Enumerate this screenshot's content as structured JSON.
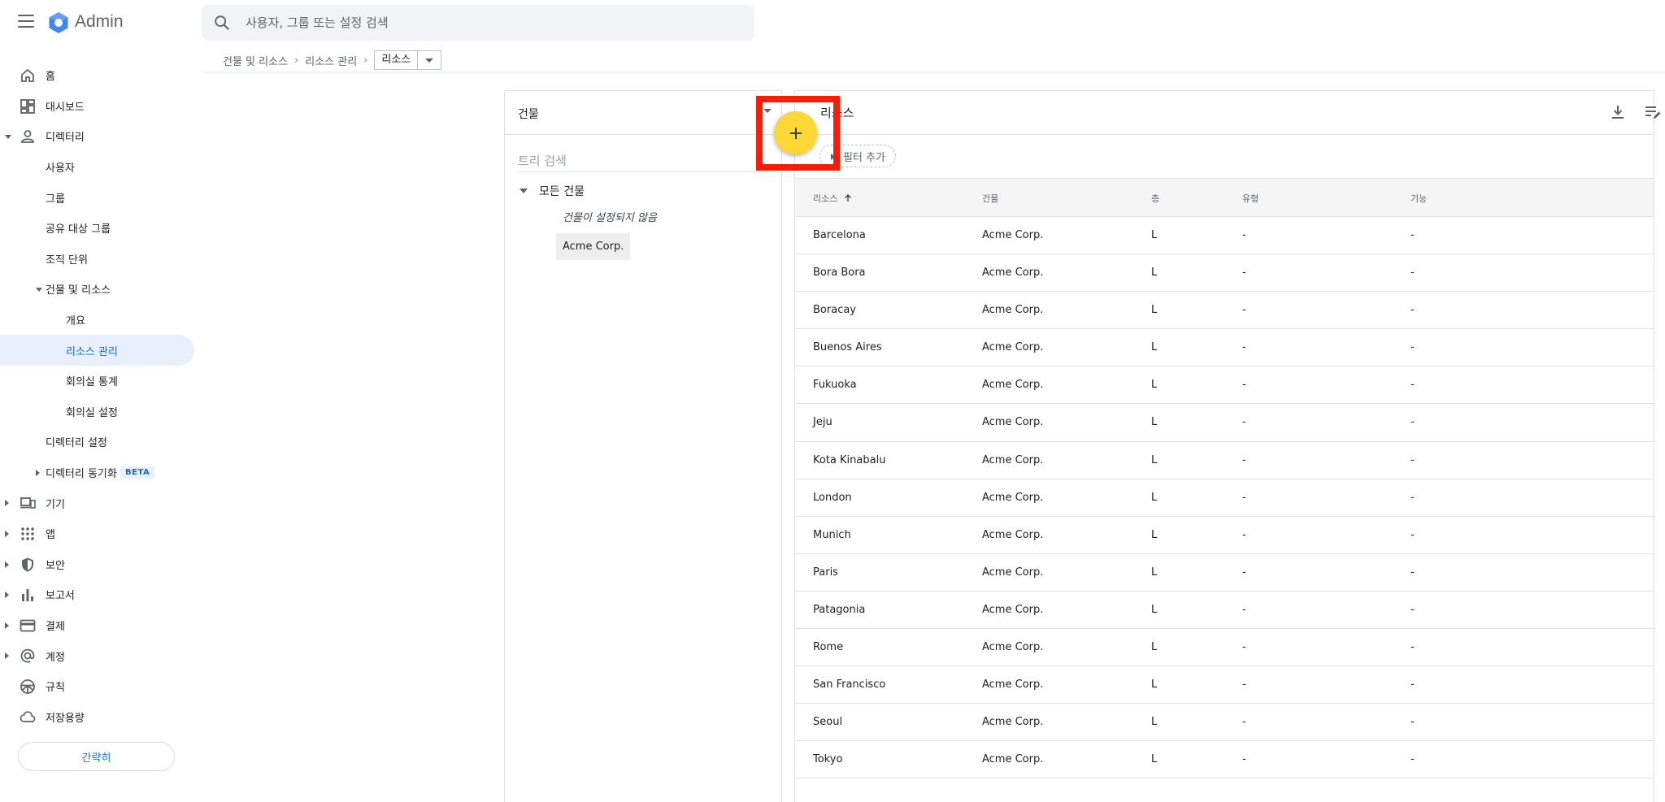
{
  "header": {
    "app_name": "Admin",
    "search_placeholder": "사용자, 그룹 또는 설정 검색"
  },
  "breadcrumb": {
    "items": [
      "건물 및 리소스",
      "리소스 관리"
    ],
    "current": "리소스"
  },
  "sidebar": {
    "items": [
      {
        "label": "홈",
        "icon": "home-icon"
      },
      {
        "label": "대시보드",
        "icon": "dashboard-icon"
      },
      {
        "label": "디렉터리",
        "icon": "person-icon"
      },
      {
        "label": "사용자"
      },
      {
        "label": "그룹"
      },
      {
        "label": "공유 대상 그룹"
      },
      {
        "label": "조직 단위"
      },
      {
        "label": "건물 및 리소스"
      },
      {
        "label": "개요"
      },
      {
        "label": "리소스 관리"
      },
      {
        "label": "회의실 통계"
      },
      {
        "label": "회의실 설정"
      },
      {
        "label": "디렉터리 설정"
      },
      {
        "label": "디렉터리 동기화",
        "badge": "BETA"
      },
      {
        "label": "기기",
        "icon": "devices-icon"
      },
      {
        "label": "앱",
        "icon": "apps-grid-icon"
      },
      {
        "label": "보안",
        "icon": "shield-icon"
      },
      {
        "label": "보고서",
        "icon": "bar-chart-icon"
      },
      {
        "label": "결제",
        "icon": "credit-card-icon"
      },
      {
        "label": "계정",
        "icon": "at-sign-icon"
      },
      {
        "label": "규칙",
        "icon": "steering-wheel-icon"
      },
      {
        "label": "저장용량",
        "icon": "cloud-icon"
      }
    ],
    "compact_label": "간략히"
  },
  "buildings_panel": {
    "title": "건물",
    "tree_search_placeholder": "트리 검색",
    "root_label": "모든 건물",
    "unset_label": "건물이 설정되지 않음",
    "selected_building": "Acme Corp."
  },
  "resources_panel": {
    "title": "리소스",
    "filter_label": "필터 추가",
    "columns": [
      "리소스",
      "건물",
      "층",
      "유형",
      "기능"
    ],
    "rows": [
      [
        "Barcelona",
        "Acme Corp.",
        "L",
        "-",
        "-"
      ],
      [
        "Bora Bora",
        "Acme Corp.",
        "L",
        "-",
        "-"
      ],
      [
        "Boracay",
        "Acme Corp.",
        "L",
        "-",
        "-"
      ],
      [
        "Buenos Aires",
        "Acme Corp.",
        "L",
        "-",
        "-"
      ],
      [
        "Fukuoka",
        "Acme Corp.",
        "L",
        "-",
        "-"
      ],
      [
        "Jeju",
        "Acme Corp.",
        "L",
        "-",
        "-"
      ],
      [
        "Kota Kinabalu",
        "Acme Corp.",
        "L",
        "-",
        "-"
      ],
      [
        "London",
        "Acme Corp.",
        "L",
        "-",
        "-"
      ],
      [
        "Munich",
        "Acme Corp.",
        "L",
        "-",
        "-"
      ],
      [
        "Paris",
        "Acme Corp.",
        "L",
        "-",
        "-"
      ],
      [
        "Patagonia",
        "Acme Corp.",
        "L",
        "-",
        "-"
      ],
      [
        "Rome",
        "Acme Corp.",
        "L",
        "-",
        "-"
      ],
      [
        "San Francisco",
        "Acme Corp.",
        "L",
        "-",
        "-"
      ],
      [
        "Seoul",
        "Acme Corp.",
        "L",
        "-",
        "-"
      ],
      [
        "Tokyo",
        "Acme Corp.",
        "L",
        "-",
        "-"
      ]
    ]
  },
  "colors": {
    "fab": "#fdd835",
    "highlight": "#ff1a00",
    "active_nav": "#e8f0fe",
    "accent": "#1967d2"
  }
}
